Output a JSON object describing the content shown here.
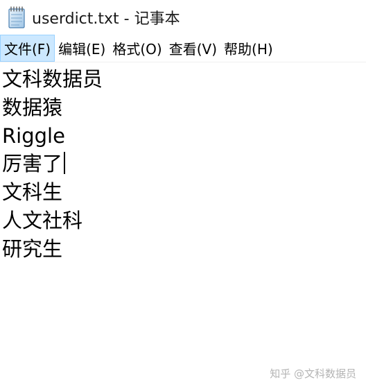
{
  "window": {
    "title": "userdict.txt - 记事本",
    "app_icon": "notepad-icon"
  },
  "menubar": {
    "items": [
      {
        "label": "文件(F)",
        "active": true
      },
      {
        "label": "编辑(E)",
        "active": false
      },
      {
        "label": "格式(O)",
        "active": false
      },
      {
        "label": "查看(V)",
        "active": false
      },
      {
        "label": "帮助(H)",
        "active": false
      }
    ]
  },
  "editor": {
    "lines": [
      "文科数据员",
      "数据猿",
      "Riggle",
      "厉害了",
      "文科生",
      "人文社科",
      "研究生"
    ]
  },
  "watermark": {
    "text": "知乎 @文科数据员"
  },
  "colors": {
    "menu_active_bg": "#cce8ff",
    "menu_active_border": "#99d1ff",
    "watermark": "#b4b4b4"
  }
}
